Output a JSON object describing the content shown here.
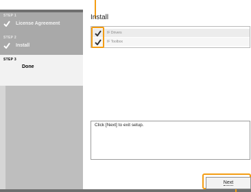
{
  "sidebar": {
    "steps": [
      {
        "number": "STEP 1",
        "label": "License Agreement",
        "state": "completed"
      },
      {
        "number": "STEP 2",
        "label": "Install",
        "state": "completed"
      },
      {
        "number": "STEP 3",
        "label": "Done",
        "state": "current"
      }
    ]
  },
  "main": {
    "title": "Install",
    "components": [
      {
        "label": "IF Drivers",
        "checked": true
      },
      {
        "label": "IF Toolbox",
        "checked": true
      }
    ],
    "message": "Click [Next] to exit setup.",
    "next_label": "Next"
  },
  "colors": {
    "highlight": "#f39c12",
    "sidebar_dark": "#a9a9a9",
    "sidebar_light": "#d6d6d6"
  },
  "icons": {
    "step_completed": "checkmark-icon",
    "component_checked": "checkmark-icon"
  }
}
